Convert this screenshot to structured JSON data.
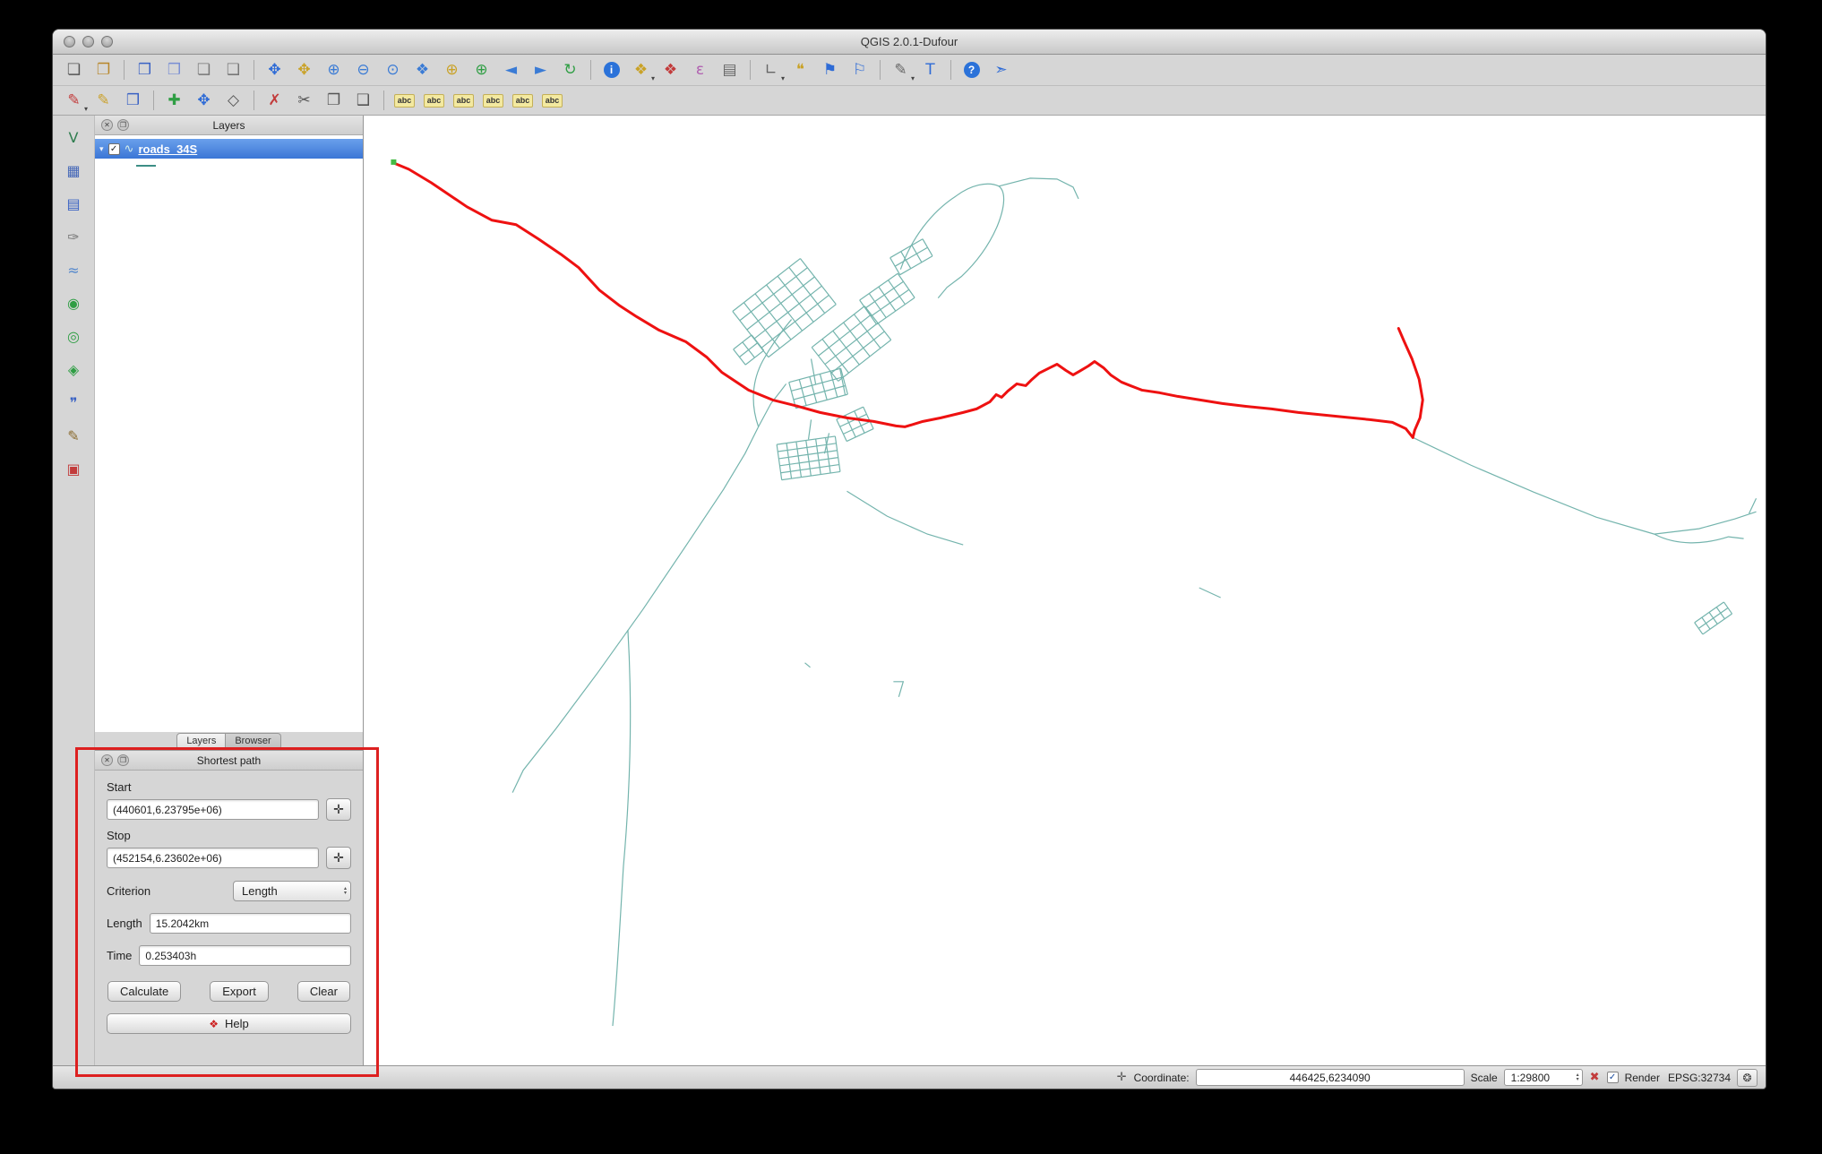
{
  "window": {
    "title": "QGIS 2.0.1-Dufour"
  },
  "panel_buttons": {
    "close": "✕",
    "detach": "❐"
  },
  "toolbars": {
    "main": [
      {
        "name": "new-project",
        "glyph": "❏",
        "color": "#555"
      },
      {
        "name": "open-project",
        "glyph": "❐",
        "color": "#b8872b"
      },
      {
        "sep": true
      },
      {
        "name": "save-project",
        "glyph": "❒",
        "color": "#3a62c4"
      },
      {
        "name": "save-project-as",
        "glyph": "❒",
        "color": "#7a8fd4"
      },
      {
        "name": "new-print-composer",
        "glyph": "❏",
        "color": "#777"
      },
      {
        "name": "composer-manager",
        "glyph": "❑",
        "color": "#777"
      },
      {
        "sep": true
      },
      {
        "name": "pan-map",
        "glyph": "✥",
        "color": "#2e6bd6"
      },
      {
        "name": "pan-to-selection",
        "glyph": "✥",
        "color": "#c9a227"
      },
      {
        "name": "zoom-in",
        "glyph": "⊕",
        "color": "#3a7bd5"
      },
      {
        "name": "zoom-out",
        "glyph": "⊖",
        "color": "#3a7bd5"
      },
      {
        "name": "zoom-actual-size",
        "glyph": "⊙",
        "color": "#3a7bd5"
      },
      {
        "name": "zoom-full-extent",
        "glyph": "❖",
        "color": "#3a7bd5"
      },
      {
        "name": "zoom-to-selection",
        "glyph": "⊕",
        "color": "#c9a227"
      },
      {
        "name": "zoom-to-layer",
        "glyph": "⊕",
        "color": "#2f9e44"
      },
      {
        "name": "zoom-last",
        "glyph": "◄",
        "color": "#3a7bd5"
      },
      {
        "name": "zoom-next",
        "glyph": "►",
        "color": "#3a7bd5"
      },
      {
        "name": "refresh-map",
        "glyph": "↻",
        "color": "#2f9e44"
      },
      {
        "sep": true
      },
      {
        "name": "identify-features",
        "glyph": "i",
        "cls": "round"
      },
      {
        "name": "select-features",
        "glyph": "❖",
        "color": "#c9a227",
        "dd": true
      },
      {
        "name": "deselect-features",
        "glyph": "❖",
        "color": "#c23b3b"
      },
      {
        "name": "select-by-expression",
        "glyph": "ε",
        "color": "#b05fb0"
      },
      {
        "name": "open-attribute-table",
        "glyph": "▤",
        "color": "#666"
      },
      {
        "sep": true
      },
      {
        "name": "measure",
        "glyph": "∟",
        "color": "#666",
        "dd": true
      },
      {
        "name": "map-tips",
        "glyph": "❝",
        "color": "#c9a227"
      },
      {
        "name": "new-bookmark",
        "glyph": "⚑",
        "color": "#2e6bd6"
      },
      {
        "name": "show-bookmarks",
        "glyph": "⚐",
        "color": "#2e6bd6"
      },
      {
        "sep": true
      },
      {
        "name": "annotation",
        "glyph": "✎",
        "color": "#666",
        "dd": true
      },
      {
        "name": "text-annotation",
        "glyph": "T",
        "color": "#2e6bd6"
      },
      {
        "sep": true
      },
      {
        "name": "help-contents",
        "glyph": "?",
        "cls": "round"
      },
      {
        "name": "whats-this",
        "glyph": "➣",
        "color": "#2e6bd6"
      }
    ],
    "edit": [
      {
        "name": "current-edits",
        "glyph": "✎",
        "color": "#c23b3b",
        "dd": true
      },
      {
        "name": "toggle-editing",
        "glyph": "✎",
        "color": "#caa12c"
      },
      {
        "name": "save-layer-edits",
        "glyph": "❒",
        "color": "#3a62c4"
      },
      {
        "sep": true
      },
      {
        "name": "add-feature",
        "glyph": "✚",
        "color": "#2f9e44"
      },
      {
        "name": "move-feature",
        "glyph": "✥",
        "color": "#2e6bd6"
      },
      {
        "name": "node-tool",
        "glyph": "◇",
        "color": "#555"
      },
      {
        "sep": true
      },
      {
        "name": "delete-selected",
        "glyph": "✗",
        "color": "#c23b3b"
      },
      {
        "name": "cut-features",
        "glyph": "✂",
        "color": "#555"
      },
      {
        "name": "copy-features",
        "glyph": "❐",
        "color": "#555"
      },
      {
        "name": "paste-features",
        "glyph": "❑",
        "color": "#555"
      },
      {
        "sep": true
      },
      {
        "name": "labeling-options",
        "glyph": "abc",
        "cls": "abc"
      },
      {
        "name": "label-move",
        "glyph": "abc",
        "cls": "abc"
      },
      {
        "name": "label-rotate",
        "glyph": "abc",
        "cls": "abc"
      },
      {
        "name": "label-pin",
        "glyph": "abc",
        "cls": "abc"
      },
      {
        "name": "label-show-hide",
        "glyph": "abc",
        "cls": "abc"
      },
      {
        "name": "label-properties",
        "glyph": "abc",
        "cls": "abc"
      }
    ],
    "manage_layers": [
      {
        "name": "add-vector-layer",
        "glyph": "V",
        "color": "#2f7d4f"
      },
      {
        "name": "add-raster-layer",
        "glyph": "▦",
        "color": "#4668b8"
      },
      {
        "name": "add-postgis-layer",
        "glyph": "▤",
        "color": "#3a62c4"
      },
      {
        "name": "add-spatialite-layer",
        "glyph": "✑",
        "color": "#777"
      },
      {
        "name": "add-mssql-layer",
        "glyph": "≈",
        "color": "#5588cc"
      },
      {
        "name": "add-wms-layer",
        "glyph": "◉",
        "color": "#2f9e44"
      },
      {
        "name": "add-wcs-layer",
        "glyph": "◎",
        "color": "#2f9e44"
      },
      {
        "name": "add-wfs-layer",
        "glyph": "◈",
        "color": "#2f9e44"
      },
      {
        "name": "add-delimited-text-layer",
        "glyph": "❞",
        "color": "#3a62c4"
      },
      {
        "name": "new-shapefile-layer",
        "glyph": "✎",
        "color": "#8a6b2f"
      },
      {
        "name": "remove-layer",
        "glyph": "▣",
        "color": "#c23b3b"
      }
    ]
  },
  "layers_panel": {
    "title": "Layers",
    "layers": [
      {
        "name": "roads_34S",
        "checked": true,
        "icon_glyph": "∿"
      }
    ],
    "tabs": [
      {
        "label": "Layers",
        "active": true
      },
      {
        "label": "Browser",
        "active": false
      }
    ]
  },
  "shortest_path_panel": {
    "title": "Shortest path",
    "start_label": "Start",
    "start_value": "(440601,6.23795e+06)",
    "stop_label": "Stop",
    "stop_value": "(452154,6.23602e+06)",
    "capture_glyph": "✛",
    "criterion_label": "Criterion",
    "criterion_value": "Length",
    "length_label": "Length",
    "length_value": "15.2042km",
    "time_label": "Time",
    "time_value": "0.253403h",
    "buttons": {
      "calculate": "Calculate",
      "export": "Export",
      "clear": "Clear",
      "help": "Help",
      "help_icon_glyph": "❖"
    }
  },
  "status_bar": {
    "mouse_position_icon": "✛",
    "coordinate_label": "Coordinate:",
    "coordinate_value": "446425,6234090",
    "scale_label": "Scale",
    "scale_value": "1:29800",
    "stop_render_icon": "✖",
    "render_label": "Render",
    "render_checked": true,
    "crs": "EPSG:32734",
    "crs_button_icon": "❂"
  },
  "map": {
    "layer_name": "roads_34S",
    "road_color": "#74b4ad",
    "route_color": "#ee1111",
    "start_marker_color": "#44bb44",
    "background": "#ffffff"
  }
}
